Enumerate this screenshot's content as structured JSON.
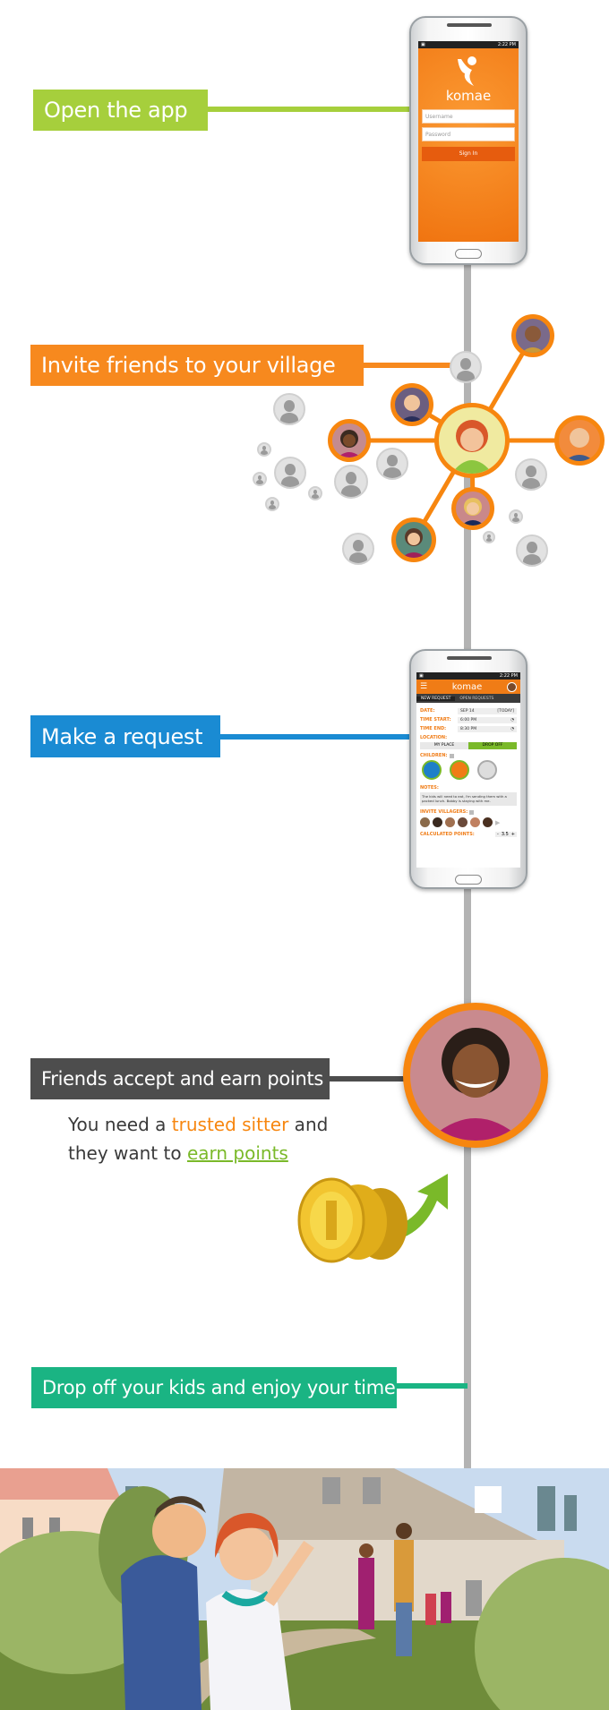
{
  "colors": {
    "step1": "#a6cf3c",
    "step2": "#f7891e",
    "step3": "#1a8bd3",
    "step4": "#4d4d4d",
    "step5": "#1ab483",
    "timeline": "#b3b3b3",
    "brand": "#f7860f"
  },
  "steps": [
    {
      "label": "Open the app"
    },
    {
      "label": "Invite friends to your village"
    },
    {
      "label": "Make a request"
    },
    {
      "label": "Friends accept and earn points"
    },
    {
      "label": "Drop off your kids and enjoy your time"
    }
  ],
  "explainer": {
    "part1": "You need a ",
    "highlight1": "trusted sitter",
    "part2": " and",
    "part3": "they want to ",
    "highlight2": "earn points"
  },
  "login_phone": {
    "time": "2:22 PM",
    "app_name": "komae",
    "username_placeholder": "Username",
    "password_placeholder": "Password",
    "signin_label": "Sign In"
  },
  "request_phone": {
    "time": "2:22 PM",
    "app_name": "komae",
    "tabs": [
      "NEW REQUEST",
      "OPEN REQUESTS"
    ],
    "date_label": "DATE:",
    "date_value": "SEP 14",
    "date_today": "[TODAY]",
    "time_start_label": "TIME START:",
    "time_start_value": "6:00 PM",
    "time_end_label": "TIME END:",
    "time_end_value": "8:30 PM",
    "location_label": "LOCATION:",
    "location_options": [
      "MY PLACE",
      "DROP OFF"
    ],
    "location_selected": "DROP OFF",
    "children_label": "CHILDREN:",
    "notes_label": "NOTES:",
    "notes_value": "The kids will need to eat, I'm sending them with a packed lunch. Bobby is staying with me.",
    "invite_label": "INVITE VILLAGERS:",
    "points_label": "CALCULATED POINTS:",
    "points_minus": "-",
    "points_value": "3.5",
    "points_plus": "+"
  }
}
